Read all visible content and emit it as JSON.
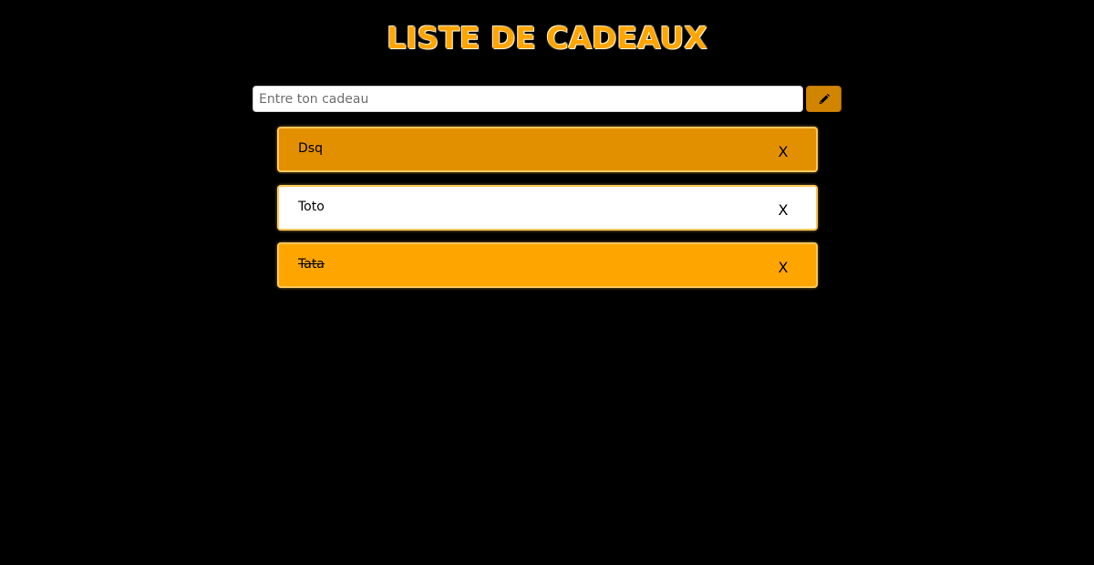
{
  "header": {
    "title": "LISTE DE CADEAUX"
  },
  "form": {
    "placeholder": "Entre ton cadeau",
    "value": "",
    "submit_icon": "pencil-icon"
  },
  "gifts": [
    {
      "name": "Dsq",
      "done": false,
      "background": "#e29000",
      "delete_label": "X"
    },
    {
      "name": "Toto",
      "done": false,
      "background": "#ffffff",
      "delete_label": "X"
    },
    {
      "name": "Tata",
      "done": true,
      "background": "#ffa500",
      "delete_label": "X"
    }
  ],
  "colors": {
    "page_background": "#000000",
    "title": "#ffa500",
    "button": "#d08400",
    "item_border": "#ffc85a"
  }
}
